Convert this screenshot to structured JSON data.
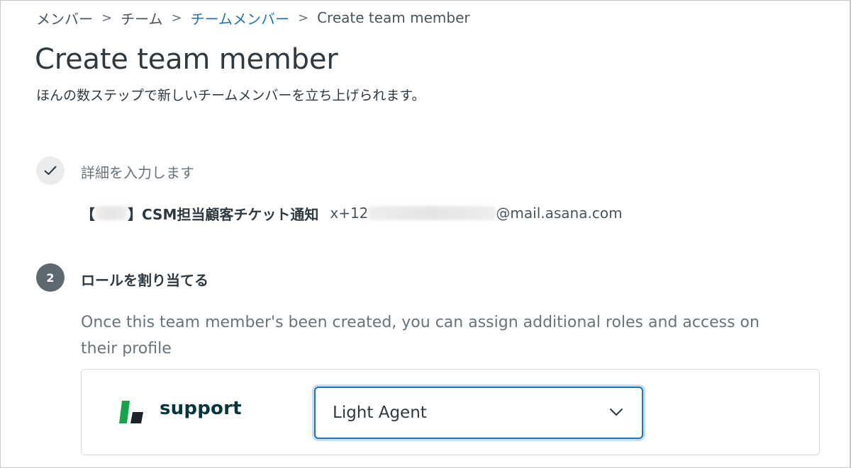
{
  "breadcrumb": {
    "items": [
      "メンバー",
      "チーム",
      "チームメンバー",
      "Create team member"
    ],
    "separator": ">"
  },
  "page": {
    "title": "Create team member",
    "subtitle": "ほんの数ステップで新しいチームメンバーを立ち上げられます。"
  },
  "steps": {
    "step1": {
      "label": "詳細を入力します",
      "detail_name_prefix": "【",
      "detail_name_suffix": "】CSM担当顧客チケット通知",
      "detail_email_prefix": "x+12",
      "detail_email_suffix": "@mail.asana.com"
    },
    "step2": {
      "number": "2",
      "label": "ロールを割り当てる",
      "description": "Once this team member's been created, you can assign additional roles and access on their profile"
    }
  },
  "role_card": {
    "product_name": "support",
    "selected_role": "Light Agent"
  },
  "colors": {
    "link": "#1f73b7",
    "logo_green": "#17a34a",
    "logo_dark": "#03363d",
    "focus_border": "#1f73b7"
  },
  "icons": {
    "step1": "checkmark-icon",
    "select": "chevron-down-icon",
    "product": "zendesk-support-logo"
  }
}
